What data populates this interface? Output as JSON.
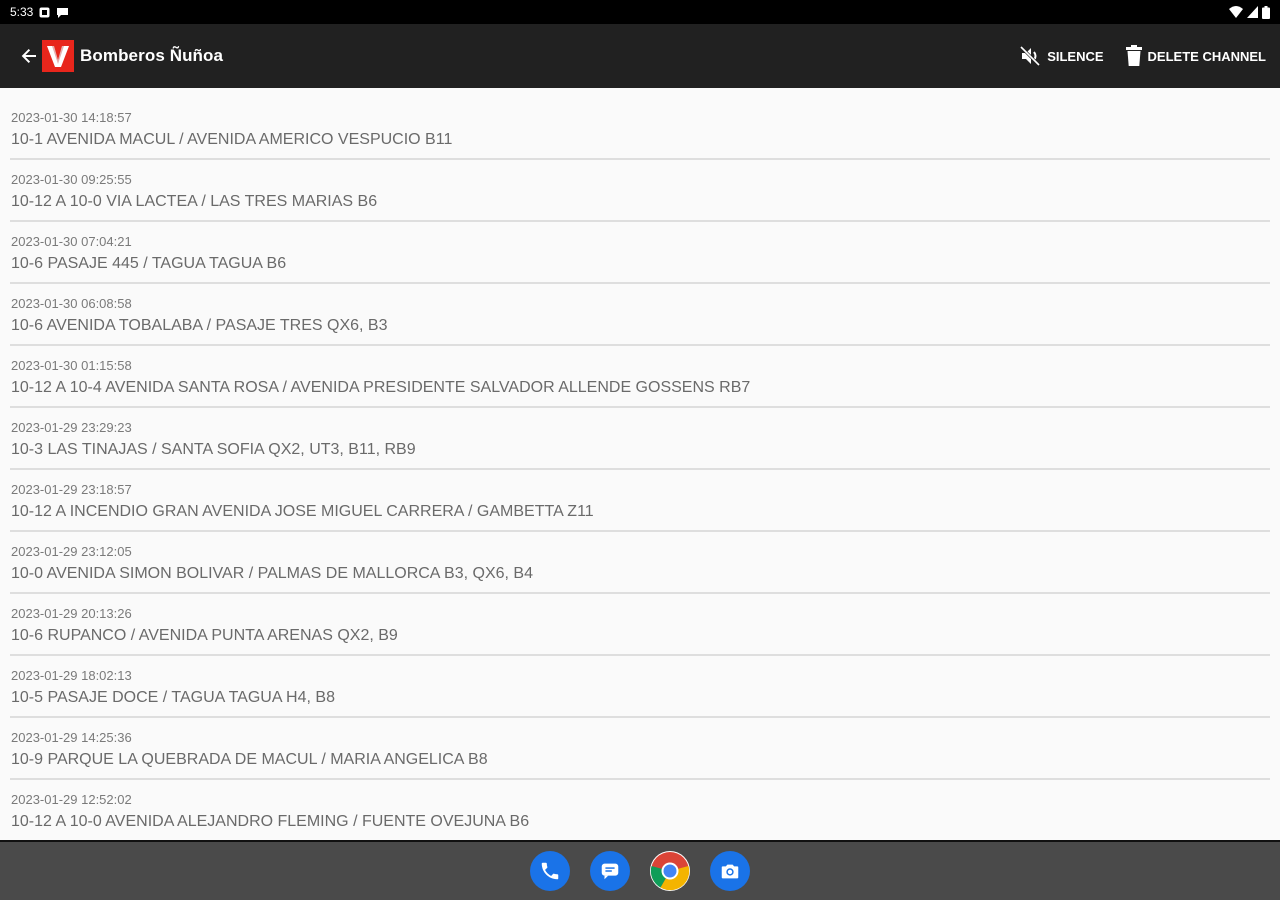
{
  "status_bar": {
    "time": "5:33"
  },
  "app_bar": {
    "title": "Bomberos Ñuñoa",
    "logo_letter": "V",
    "actions": {
      "silence": "SILENCE",
      "delete_channel": "DELETE CHANNEL"
    }
  },
  "messages": [
    {
      "time": "2023-01-30 14:18:57",
      "text": "10-1 AVENIDA MACUL / AVENIDA AMERICO VESPUCIO B11"
    },
    {
      "time": "2023-01-30 09:25:55",
      "text": "10-12 A 10-0 VIA LACTEA / LAS TRES MARIAS B6"
    },
    {
      "time": "2023-01-30 07:04:21",
      "text": "10-6 PASAJE 445 / TAGUA TAGUA B6"
    },
    {
      "time": "2023-01-30 06:08:58",
      "text": "10-6 AVENIDA TOBALABA / PASAJE TRES QX6, B3"
    },
    {
      "time": "2023-01-30 01:15:58",
      "text": "10-12 A 10-4 AVENIDA SANTA ROSA / AVENIDA PRESIDENTE SALVADOR ALLENDE GOSSENS RB7"
    },
    {
      "time": "2023-01-29 23:29:23",
      "text": "10-3 LAS TINAJAS / SANTA SOFIA QX2, UT3, B11, RB9"
    },
    {
      "time": "2023-01-29 23:18:57",
      "text": "10-12 A INCENDIO GRAN AVENIDA JOSE MIGUEL CARRERA / GAMBETTA Z11"
    },
    {
      "time": "2023-01-29 23:12:05",
      "text": "10-0 AVENIDA SIMON BOLIVAR / PALMAS DE MALLORCA B3, QX6, B4"
    },
    {
      "time": "2023-01-29 20:13:26",
      "text": "10-6 RUPANCO / AVENIDA PUNTA ARENAS QX2, B9"
    },
    {
      "time": "2023-01-29 18:02:13",
      "text": "10-5 PASAJE DOCE / TAGUA TAGUA H4, B8"
    },
    {
      "time": "2023-01-29 14:25:36",
      "text": "10-9 PARQUE LA QUEBRADA DE MACUL / MARIA ANGELICA B8"
    },
    {
      "time": "2023-01-29 12:52:02",
      "text": "10-12 A 10-0 AVENIDA ALEJANDRO FLEMING / FUENTE OVEJUNA B6"
    }
  ],
  "dock": {
    "apps": [
      "phone-icon",
      "messages-icon",
      "chrome-icon",
      "camera-icon"
    ]
  },
  "colors": {
    "app_bar": "#212121",
    "logo_red": "#e8261c",
    "list_bg": "#fafafa",
    "divider": "#dedede",
    "nav_bar": "#4a4a4a",
    "dock_blue": "#1a73e8"
  }
}
